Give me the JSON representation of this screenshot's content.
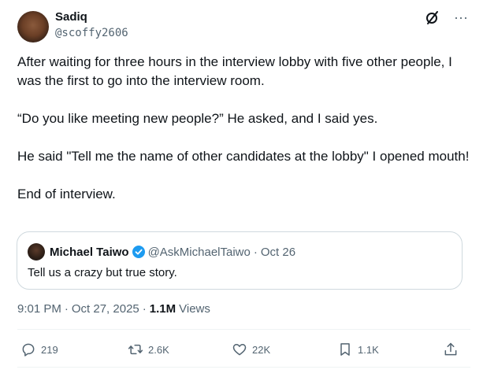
{
  "author": {
    "name": "Sadiq",
    "handle": "@scoffy2606"
  },
  "header_icons": [
    "grok-icon",
    "more-icon"
  ],
  "tweet": {
    "paragraphs": [
      "After waiting for three hours in the interview lobby with five other people, I was the first to go into the interview room.",
      "“Do you like meeting new people?” He asked, and I said yes.",
      "He said \"Tell me the name of other candidates at the lobby\" I opened mouth!",
      "End of interview."
    ]
  },
  "quote": {
    "name": "Michael Taiwo",
    "handle": "@AskMichaelTaiwo",
    "separator": "·",
    "date": "Oct 26",
    "text": "Tell us a crazy but true story.",
    "verified_color": "#1d9bf0"
  },
  "meta": {
    "time": "9:01 PM",
    "separator": "·",
    "date": "Oct 27, 2025",
    "views_count": "1.1M",
    "views_label": "Views"
  },
  "actions": {
    "replies": "219",
    "reposts": "2.6K",
    "likes": "22K",
    "bookmarks": "1.1K"
  },
  "colors": {
    "text": "#0f1419",
    "secondary": "#536471",
    "border": "#cfd9de",
    "accent": "#1d9bf0"
  }
}
